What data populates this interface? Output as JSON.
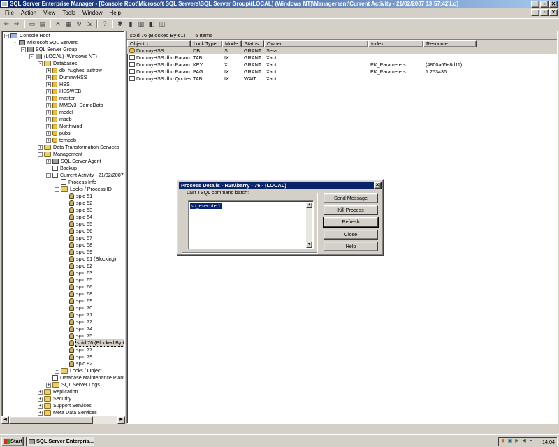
{
  "window": {
    "title": "SQL Server Enterprise Manager - [Console Root\\Microsoft SQL Servers\\SQL Server Group\\(LOCAL) (Windows NT)\\Management\\Current Activity - 21/02/2007 13:57:42\\Lo]",
    "minimize": "_",
    "restore": "▫",
    "close": "✕"
  },
  "menu": [
    "File",
    "Action",
    "View",
    "Tools",
    "Window",
    "Help"
  ],
  "toolbar_icons": [
    "back-icon",
    "forward-icon",
    "up-folder-icon",
    "show-tree-icon",
    "delete-icon",
    "properties-icon",
    "refresh-icon",
    "export-icon",
    "help-icon",
    "wizard-icon",
    "new-server-icon",
    "new-database-icon",
    "new-login-icon",
    "new-job-icon"
  ],
  "tree": {
    "items": [
      {
        "label": "Console Root",
        "depth": 0,
        "exp": "-",
        "icon": "console"
      },
      {
        "label": "Microsoft SQL Servers",
        "depth": 1,
        "exp": "-",
        "icon": "server"
      },
      {
        "label": "SQL Server Group",
        "depth": 2,
        "exp": "-",
        "icon": "server"
      },
      {
        "label": "(LOCAL) (Windows NT)",
        "depth": 3,
        "exp": "-",
        "icon": "server"
      },
      {
        "label": "Databases",
        "depth": 4,
        "exp": "-",
        "icon": "folder"
      },
      {
        "label": "db_hughes_astrow",
        "depth": 5,
        "exp": "+",
        "icon": "db"
      },
      {
        "label": "DummyHSS",
        "depth": 5,
        "exp": "+",
        "icon": "db"
      },
      {
        "label": "HSS",
        "depth": 5,
        "exp": "+",
        "icon": "db"
      },
      {
        "label": "HSSWEB",
        "depth": 5,
        "exp": "+",
        "icon": "db"
      },
      {
        "label": "master",
        "depth": 5,
        "exp": "+",
        "icon": "db"
      },
      {
        "label": "MMSv3_DemoData",
        "depth": 5,
        "exp": "+",
        "icon": "db"
      },
      {
        "label": "model",
        "depth": 5,
        "exp": "+",
        "icon": "db"
      },
      {
        "label": "msdb",
        "depth": 5,
        "exp": "+",
        "icon": "db"
      },
      {
        "label": "Northwind",
        "depth": 5,
        "exp": "+",
        "icon": "db"
      },
      {
        "label": "pubs",
        "depth": 5,
        "exp": "+",
        "icon": "db"
      },
      {
        "label": "tempdb",
        "depth": 5,
        "exp": "+",
        "icon": "db"
      },
      {
        "label": "Data Transformation Services",
        "depth": 4,
        "exp": "+",
        "icon": "folder"
      },
      {
        "label": "Management",
        "depth": 4,
        "exp": "-",
        "icon": "folder"
      },
      {
        "label": "SQL Server Agent",
        "depth": 5,
        "exp": "+",
        "icon": "server"
      },
      {
        "label": "Backup",
        "depth": 5,
        "exp": "",
        "icon": "doc"
      },
      {
        "label": "Current Activity - 21/02/2007 13:5",
        "depth": 5,
        "exp": "-",
        "icon": "doc"
      },
      {
        "label": "Process Info",
        "depth": 6,
        "exp": "",
        "icon": "doc"
      },
      {
        "label": "Locks / Process ID",
        "depth": 6,
        "exp": "-",
        "icon": "folder"
      },
      {
        "label": "spid 51",
        "depth": 7,
        "exp": "",
        "icon": "lock"
      },
      {
        "label": "spid 52",
        "depth": 7,
        "exp": "",
        "icon": "lock"
      },
      {
        "label": "spid 53",
        "depth": 7,
        "exp": "",
        "icon": "lock"
      },
      {
        "label": "spid 54",
        "depth": 7,
        "exp": "",
        "icon": "lock"
      },
      {
        "label": "spid 55",
        "depth": 7,
        "exp": "",
        "icon": "lock"
      },
      {
        "label": "spid 56",
        "depth": 7,
        "exp": "",
        "icon": "lock"
      },
      {
        "label": "spid 57",
        "depth": 7,
        "exp": "",
        "icon": "lock"
      },
      {
        "label": "spid 58",
        "depth": 7,
        "exp": "",
        "icon": "lock"
      },
      {
        "label": "spid 59",
        "depth": 7,
        "exp": "",
        "icon": "lock"
      },
      {
        "label": "spid 61 (Blocking)",
        "depth": 7,
        "exp": "",
        "icon": "lock"
      },
      {
        "label": "spid 62",
        "depth": 7,
        "exp": "",
        "icon": "lock"
      },
      {
        "label": "spid 63",
        "depth": 7,
        "exp": "",
        "icon": "lock"
      },
      {
        "label": "spid 65",
        "depth": 7,
        "exp": "",
        "icon": "lock"
      },
      {
        "label": "spid 66",
        "depth": 7,
        "exp": "",
        "icon": "lock"
      },
      {
        "label": "spid 68",
        "depth": 7,
        "exp": "",
        "icon": "lock"
      },
      {
        "label": "spid 69",
        "depth": 7,
        "exp": "",
        "icon": "lock"
      },
      {
        "label": "spid 70",
        "depth": 7,
        "exp": "",
        "icon": "lock"
      },
      {
        "label": "spid 71",
        "depth": 7,
        "exp": "",
        "icon": "lock"
      },
      {
        "label": "spid 72",
        "depth": 7,
        "exp": "",
        "icon": "lock"
      },
      {
        "label": "spid 74",
        "depth": 7,
        "exp": "",
        "icon": "lock"
      },
      {
        "label": "spid 75",
        "depth": 7,
        "exp": "",
        "icon": "lock"
      },
      {
        "label": "spid 76 (Blocked By 61)",
        "depth": 7,
        "exp": "",
        "icon": "lock",
        "selected": true
      },
      {
        "label": "spid 77",
        "depth": 7,
        "exp": "",
        "icon": "lock"
      },
      {
        "label": "spid 79",
        "depth": 7,
        "exp": "",
        "icon": "lock"
      },
      {
        "label": "spid 82",
        "depth": 7,
        "exp": "",
        "icon": "lock"
      },
      {
        "label": "Locks / Object",
        "depth": 6,
        "exp": "+",
        "icon": "folder"
      },
      {
        "label": "Database Maintenance Plans",
        "depth": 5,
        "exp": "",
        "icon": "doc"
      },
      {
        "label": "SQL Server Logs",
        "depth": 5,
        "exp": "+",
        "icon": "folder"
      },
      {
        "label": "Replication",
        "depth": 4,
        "exp": "+",
        "icon": "folder"
      },
      {
        "label": "Security",
        "depth": 4,
        "exp": "+",
        "icon": "folder"
      },
      {
        "label": "Support Services",
        "depth": 4,
        "exp": "+",
        "icon": "folder"
      },
      {
        "label": "Meta Data Services",
        "depth": 4,
        "exp": "+",
        "icon": "folder"
      }
    ]
  },
  "details": {
    "header_title": "spid 76 (Blocked By 61)",
    "header_count": "5 Items",
    "columns": [
      "Object",
      "Lock Type",
      "Mode",
      "Status",
      "Owner",
      "Index",
      "Resource"
    ],
    "sort_indicator": "▲",
    "rows": [
      {
        "cells": [
          "DummyHSS",
          "DB",
          "S",
          "GRANT",
          "Sess",
          "",
          ""
        ],
        "icon": "db",
        "selected": true
      },
      {
        "cells": [
          "DummyHSS.dbo.Param...",
          "TAB",
          "IX",
          "GRANT",
          "Xact",
          "",
          ""
        ],
        "icon": "table"
      },
      {
        "cells": [
          "DummyHSS.dbo.Param...",
          "KEY",
          "X",
          "GRANT",
          "Xact",
          "PK_Parameters",
          "(4800a65e8d11)"
        ],
        "icon": "table"
      },
      {
        "cells": [
          "DummyHSS.dbo.Param...",
          "PAG",
          "IX",
          "GRANT",
          "Xact",
          "PK_Parameters",
          "1:253436"
        ],
        "icon": "table"
      },
      {
        "cells": [
          "DummyHSS.dbo.Quotes",
          "TAB",
          "IX",
          "WAIT",
          "Xact",
          "",
          ""
        ],
        "icon": "table"
      }
    ]
  },
  "dialog": {
    "title": "Process Details - H2K\\barry - 76 - (LOCAL)",
    "close": "✕",
    "group_label": "Last TSQL command batch:",
    "sql_text": "sp_execute;1",
    "buttons": {
      "send_message": "Send Message",
      "kill_process": "Kill Process",
      "refresh": "Refresh",
      "close": "Close",
      "help": "Help"
    }
  },
  "taskbar": {
    "start": "Start",
    "task": "SQL Server Enterpris...",
    "clock": "14:04",
    "tray_icons": [
      "shield-icon",
      "network-icon",
      "sql-service-icon",
      "speaker-icon",
      "monitor-icon"
    ]
  }
}
